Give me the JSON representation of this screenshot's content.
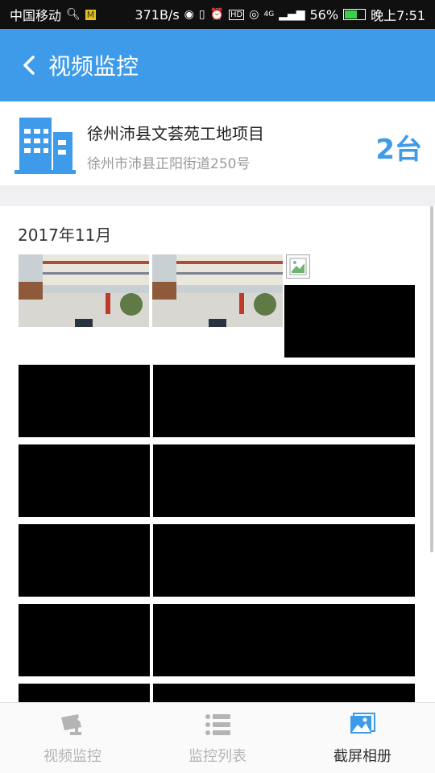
{
  "status_bar": {
    "carrier": "中国移动",
    "net_speed": "371B/s",
    "network": "4G",
    "battery": "56%",
    "time": "晚上7:51"
  },
  "app_bar": {
    "title": "视频监控",
    "back_icon": "chevron-left-icon"
  },
  "project": {
    "name": "徐州沛县文荟苑工地项目",
    "address": "徐州市沛县正阳街道250号",
    "count": "2台",
    "icon": "building-icon",
    "accent_color": "#3e9be9"
  },
  "gallery": {
    "month_label": "2017年11月",
    "thumbnail_kinds": [
      "photo",
      "photo",
      "broken",
      "black",
      "black",
      "black",
      "black",
      "black",
      "black",
      "black",
      "black",
      "black",
      "black"
    ]
  },
  "tabs": [
    {
      "label": "视频监控",
      "icon": "camera-icon",
      "active": false
    },
    {
      "label": "监控列表",
      "icon": "list-icon",
      "active": false
    },
    {
      "label": "截屏相册",
      "icon": "album-icon",
      "active": true
    }
  ]
}
